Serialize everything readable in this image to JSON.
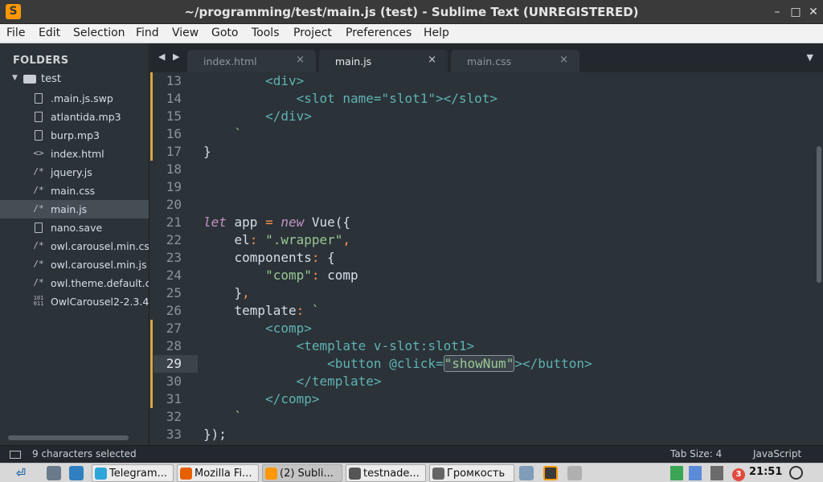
{
  "window": {
    "title": "~/programming/test/main.js (test) - Sublime Text (UNREGISTERED)",
    "app_icon_glyph": "S",
    "minimize_glyph": "–",
    "maximize_glyph": "□",
    "close_glyph": "✕"
  },
  "menu": [
    "File",
    "Edit",
    "Selection",
    "Find",
    "View",
    "Goto",
    "Tools",
    "Project",
    "Preferences",
    "Help"
  ],
  "sidebar": {
    "heading": "FOLDERS",
    "root_folder": "test",
    "files": [
      {
        "name": ".main.js.swp",
        "icon": "file-icon",
        "glyph": ""
      },
      {
        "name": "atlantida.mp3",
        "icon": "file-icon",
        "glyph": ""
      },
      {
        "name": "burp.mp3",
        "icon": "file-icon",
        "glyph": ""
      },
      {
        "name": "index.html",
        "icon": "code-file-icon",
        "glyph": "<>"
      },
      {
        "name": "jquery.js",
        "icon": "comment-file-icon",
        "glyph": "/*"
      },
      {
        "name": "main.css",
        "icon": "comment-file-icon",
        "glyph": "/*"
      },
      {
        "name": "main.js",
        "icon": "comment-file-icon",
        "glyph": "/*"
      },
      {
        "name": "nano.save",
        "icon": "file-icon",
        "glyph": ""
      },
      {
        "name": "owl.carousel.min.css",
        "icon": "comment-file-icon",
        "glyph": "/*"
      },
      {
        "name": "owl.carousel.min.js",
        "icon": "comment-file-icon",
        "glyph": "/*"
      },
      {
        "name": "owl.theme.default.cs",
        "icon": "comment-file-icon",
        "glyph": "/*"
      },
      {
        "name": "OwlCarousel2-2.3.4.",
        "icon": "binary-file-icon",
        "glyph": "101"
      }
    ],
    "active_file": "main.js"
  },
  "tabs": {
    "nav_glyph": "◀ ▶",
    "dropdown_glyph": "▼",
    "close_glyph": "×",
    "items": [
      {
        "label": "index.html",
        "active": false
      },
      {
        "label": "main.js",
        "active": true
      },
      {
        "label": "main.css",
        "active": false
      }
    ]
  },
  "editor": {
    "current_line": 29,
    "lines": [
      {
        "n": "13",
        "mod": true,
        "tokens": [
          [
            "plain",
            "        "
          ],
          [
            "tag",
            "<div>"
          ]
        ]
      },
      {
        "n": "14",
        "mod": true,
        "tokens": [
          [
            "plain",
            "            "
          ],
          [
            "tag",
            "<slot name=\"slot1\"></slot>"
          ]
        ]
      },
      {
        "n": "15",
        "mod": true,
        "tokens": [
          [
            "plain",
            "        "
          ],
          [
            "tag",
            "</div>"
          ]
        ]
      },
      {
        "n": "16",
        "mod": true,
        "tokens": [
          [
            "plain",
            "    "
          ],
          [
            "str",
            "`"
          ]
        ]
      },
      {
        "n": "17",
        "mod": true,
        "tokens": [
          [
            "plain",
            "}"
          ]
        ]
      },
      {
        "n": "18",
        "mod": false,
        "tokens": []
      },
      {
        "n": "19",
        "mod": false,
        "tokens": []
      },
      {
        "n": "20",
        "mod": false,
        "tokens": []
      },
      {
        "n": "21",
        "mod": false,
        "tokens": [
          [
            "kw",
            "let"
          ],
          [
            "plain",
            " app "
          ],
          [
            "op",
            "="
          ],
          [
            "plain",
            " "
          ],
          [
            "kw2",
            "new"
          ],
          [
            "plain",
            " Vue({"
          ]
        ]
      },
      {
        "n": "22",
        "mod": false,
        "tokens": [
          [
            "plain",
            "    el"
          ],
          [
            "op",
            ":"
          ],
          [
            "plain",
            " "
          ],
          [
            "str",
            "\".wrapper\""
          ],
          [
            "op",
            ","
          ]
        ]
      },
      {
        "n": "23",
        "mod": false,
        "tokens": [
          [
            "plain",
            "    components"
          ],
          [
            "op",
            ":"
          ],
          [
            "plain",
            " {"
          ]
        ]
      },
      {
        "n": "24",
        "mod": false,
        "tokens": [
          [
            "plain",
            "        "
          ],
          [
            "str",
            "\"comp\""
          ],
          [
            "op",
            ":"
          ],
          [
            "plain",
            " comp"
          ]
        ]
      },
      {
        "n": "25",
        "mod": false,
        "tokens": [
          [
            "plain",
            "    }"
          ],
          [
            "op",
            ","
          ]
        ]
      },
      {
        "n": "26",
        "mod": false,
        "tokens": [
          [
            "plain",
            "    template"
          ],
          [
            "op",
            ":"
          ],
          [
            "plain",
            " "
          ],
          [
            "str",
            "`"
          ]
        ]
      },
      {
        "n": "27",
        "mod": true,
        "tokens": [
          [
            "plain",
            "        "
          ],
          [
            "tag",
            "<comp>"
          ]
        ]
      },
      {
        "n": "28",
        "mod": true,
        "tokens": [
          [
            "plain",
            "            "
          ],
          [
            "tag",
            "<template v-slot:slot1>"
          ]
        ]
      },
      {
        "n": "29",
        "mod": true,
        "tokens": [
          [
            "plain",
            "                "
          ],
          [
            "tag",
            "<button @click="
          ],
          [
            "sel",
            "\"showNum\""
          ],
          [
            "tag",
            "></button>"
          ]
        ]
      },
      {
        "n": "30",
        "mod": true,
        "tokens": [
          [
            "plain",
            "            "
          ],
          [
            "tag",
            "</template>"
          ]
        ]
      },
      {
        "n": "31",
        "mod": true,
        "tokens": [
          [
            "plain",
            "        "
          ],
          [
            "tag",
            "</comp>"
          ]
        ]
      },
      {
        "n": "32",
        "mod": false,
        "tokens": [
          [
            "plain",
            "    "
          ],
          [
            "str",
            "`"
          ]
        ]
      },
      {
        "n": "33",
        "mod": false,
        "tokens": [
          [
            "plain",
            "});"
          ]
        ]
      }
    ]
  },
  "status": {
    "selection": "9 characters selected",
    "tab_size": "Tab Size: 4",
    "syntax": "JavaScript"
  },
  "taskbar": {
    "start_glyph": "⏎",
    "tasks": [
      {
        "label": "Telegram...",
        "color": "#2ea6d9",
        "active": false
      },
      {
        "label": "Mozilla Fi...",
        "color": "#e66000",
        "active": false
      },
      {
        "label": "(2) Subli...",
        "color": "#ff9800",
        "active": true
      },
      {
        "label": "testnade...",
        "color": "#555555",
        "active": false
      },
      {
        "label": "Громкость",
        "color": "#666666",
        "active": false
      }
    ],
    "badge": "3",
    "clock": "21:51"
  },
  "colors": {
    "accent": "#ff9800",
    "modified_marker": "#d9a441"
  }
}
